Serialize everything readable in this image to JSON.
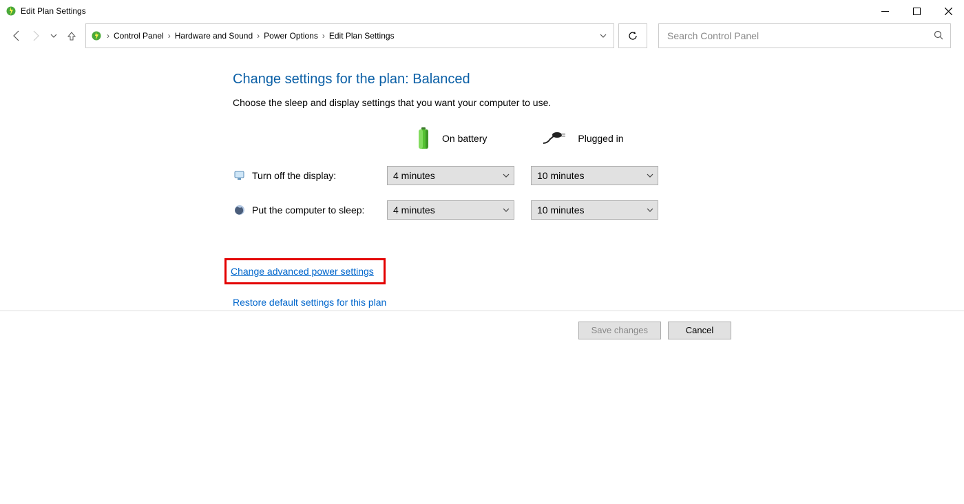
{
  "window": {
    "title": "Edit Plan Settings"
  },
  "breadcrumb": {
    "items": [
      "Control Panel",
      "Hardware and Sound",
      "Power Options",
      "Edit Plan Settings"
    ]
  },
  "search": {
    "placeholder": "Search Control Panel"
  },
  "main": {
    "heading": "Change settings for the plan: Balanced",
    "subtext": "Choose the sleep and display settings that you want your computer to use.",
    "columns": {
      "battery": "On battery",
      "plugged": "Plugged in"
    },
    "rows": {
      "display": {
        "label": "Turn off the display:",
        "battery_value": "4 minutes",
        "plugged_value": "10 minutes"
      },
      "sleep": {
        "label": "Put the computer to sleep:",
        "battery_value": "4 minutes",
        "plugged_value": "10 minutes"
      }
    },
    "advanced_link": "Change advanced power settings",
    "restore_link": "Restore default settings for this plan"
  },
  "buttons": {
    "save": "Save changes",
    "cancel": "Cancel"
  }
}
